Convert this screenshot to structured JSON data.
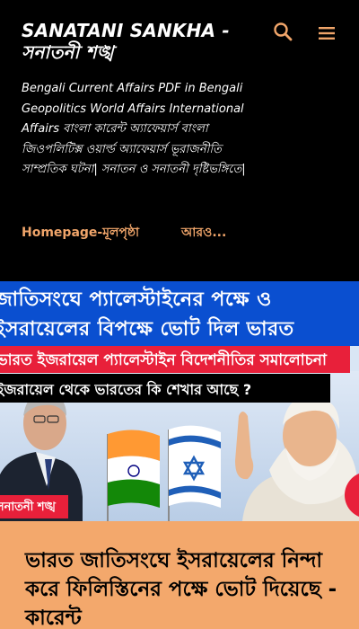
{
  "header": {
    "site_title": "SANATANI SANKHA - সনাতনী শঙ্খ",
    "description": "Bengali Current Affairs PDF in Bengali Geopolitics World Affairs International Affairs বাংলা কারেন্ট অ্যাফেয়ার্স বাংলা জিওপলিটিক্স ওয়ার্ল্ড অ্যাফেয়ার্স ভূরাজনীতি সাম্প্রতিক ঘটনা| সনাতন ও সনাতনী দৃষ্টিভঙ্গিতে|",
    "search_icon": "search-icon",
    "menu_icon": "hamburger-menu-icon"
  },
  "nav": {
    "home_label": "Homepage-মূলপৃষ্ঠা",
    "more_label": "আরও..."
  },
  "hero": {
    "line1": "জাতিসংঘে প্যালেস্টাইনের পক্ষে ও",
    "line2": "ইসরায়েলের বিপক্ষে ভোট দিল ভারত",
    "line3": "ভারত ইজরায়েল প্যালেস্টাইন বিদেশনীতির সমালোচনা",
    "line4": "ইজরায়েল থেকে ভারতের কি শেখার আছে ?",
    "watermark": "সনাতনী শঙ্খ"
  },
  "post": {
    "title": "ভারত জাতিসংঘে ইসরায়েলের নিন্দা করে ফিলিস্তিনের পক্ষে ভোট দিয়েছে - কারেন্ট"
  },
  "colors": {
    "background": "#000000",
    "accent": "#f0a56a",
    "post_background": "#f3a86c",
    "hero_blue": "#0a4fd0",
    "hero_red": "#e8203a"
  }
}
